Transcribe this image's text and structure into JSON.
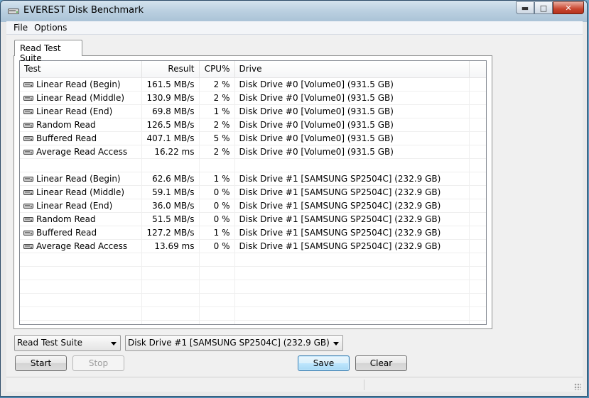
{
  "window": {
    "title": "EVEREST Disk Benchmark",
    "app_icon": "disk-drive-icon"
  },
  "menu": [
    "File",
    "Options"
  ],
  "tabs": [
    "Read Test Suite"
  ],
  "table": {
    "columns": [
      "Test",
      "Result",
      "CPU%",
      "Drive"
    ],
    "rows": [
      {
        "test": "Linear Read (Begin)",
        "result": "161.5 MB/s",
        "cpu": "2 %",
        "drive": "Disk Drive #0  [Volume0]  (931.5 GB)"
      },
      {
        "test": "Linear Read (Middle)",
        "result": "130.9 MB/s",
        "cpu": "2 %",
        "drive": "Disk Drive #0  [Volume0]  (931.5 GB)"
      },
      {
        "test": "Linear Read (End)",
        "result": "69.8 MB/s",
        "cpu": "1 %",
        "drive": "Disk Drive #0  [Volume0]  (931.5 GB)"
      },
      {
        "test": "Random Read",
        "result": "126.5 MB/s",
        "cpu": "2 %",
        "drive": "Disk Drive #0  [Volume0]  (931.5 GB)"
      },
      {
        "test": "Buffered Read",
        "result": "407.1 MB/s",
        "cpu": "5 %",
        "drive": "Disk Drive #0  [Volume0]  (931.5 GB)"
      },
      {
        "test": "Average Read Access",
        "result": "16.22 ms",
        "cpu": "2 %",
        "drive": "Disk Drive #0  [Volume0]  (931.5 GB)"
      },
      {
        "test": "",
        "result": "",
        "cpu": "",
        "drive": ""
      },
      {
        "test": "Linear Read (Begin)",
        "result": "62.6 MB/s",
        "cpu": "1 %",
        "drive": "Disk Drive #1  [SAMSUNG SP2504C]  (232.9 GB)"
      },
      {
        "test": "Linear Read (Middle)",
        "result": "59.1 MB/s",
        "cpu": "0 %",
        "drive": "Disk Drive #1  [SAMSUNG SP2504C]  (232.9 GB)"
      },
      {
        "test": "Linear Read (End)",
        "result": "36.0 MB/s",
        "cpu": "0 %",
        "drive": "Disk Drive #1  [SAMSUNG SP2504C]  (232.9 GB)"
      },
      {
        "test": "Random Read",
        "result": "51.5 MB/s",
        "cpu": "0 %",
        "drive": "Disk Drive #1  [SAMSUNG SP2504C]  (232.9 GB)"
      },
      {
        "test": "Buffered Read",
        "result": "127.2 MB/s",
        "cpu": "1 %",
        "drive": "Disk Drive #1  [SAMSUNG SP2504C]  (232.9 GB)"
      },
      {
        "test": "Average Read Access",
        "result": "13.69 ms",
        "cpu": "0 %",
        "drive": "Disk Drive #1  [SAMSUNG SP2504C]  (232.9 GB)"
      },
      {
        "test": "",
        "result": "",
        "cpu": "",
        "drive": ""
      },
      {
        "test": "",
        "result": "",
        "cpu": "",
        "drive": ""
      },
      {
        "test": "",
        "result": "",
        "cpu": "",
        "drive": ""
      },
      {
        "test": "",
        "result": "",
        "cpu": "",
        "drive": ""
      },
      {
        "test": "",
        "result": "",
        "cpu": "",
        "drive": ""
      },
      {
        "test": "",
        "result": "",
        "cpu": "",
        "drive": ""
      }
    ]
  },
  "suite_select": {
    "value": "Read Test Suite"
  },
  "drive_select": {
    "value": "Disk Drive #1  [SAMSUNG SP2504C]  (232.9 GB)"
  },
  "buttons": {
    "start": "Start",
    "stop": "Stop",
    "save": "Save",
    "clear": "Clear"
  },
  "colors": {
    "titlebar": "#bcd1e1",
    "close_button": "#c8462f",
    "default_button": "#3c7fb1"
  }
}
